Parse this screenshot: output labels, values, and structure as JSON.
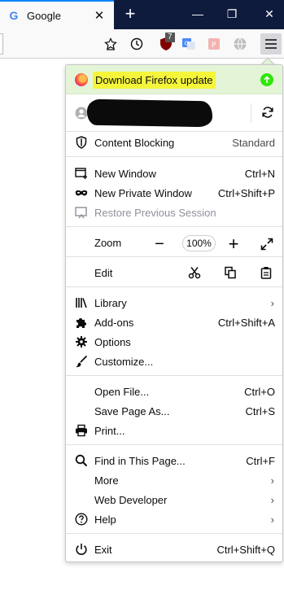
{
  "tab": {
    "favicon": "G",
    "title": "Google",
    "close": "✕"
  },
  "titlebar": {
    "new_tab": "+",
    "minimize": "—",
    "restore": "❐",
    "close": "✕"
  },
  "toolbar": {
    "icons": [
      "bookmark-star-icon",
      "history-clock-icon",
      "ublock-icon",
      "translate-icon",
      "pocket-extension-icon",
      "vpn-globe-icon",
      "hamburger-menu-icon"
    ],
    "ublock_badge": "7"
  },
  "menu": {
    "update_label": "Download Firefox update",
    "content_blocking": {
      "label": "Content Blocking",
      "value": "Standard"
    },
    "new_window": {
      "label": "New Window",
      "shortcut": "Ctrl+N"
    },
    "new_private_window": {
      "label": "New Private Window",
      "shortcut": "Ctrl+Shift+P"
    },
    "restore_session": {
      "label": "Restore Previous Session"
    },
    "zoom": {
      "label": "Zoom",
      "minus": "−",
      "value": "100%",
      "plus": "+"
    },
    "edit": {
      "label": "Edit"
    },
    "library": {
      "label": "Library",
      "chevron": "›"
    },
    "addons": {
      "label": "Add-ons",
      "shortcut": "Ctrl+Shift+A"
    },
    "options": {
      "label": "Options"
    },
    "customize": {
      "label": "Customize..."
    },
    "open_file": {
      "label": "Open File...",
      "shortcut": "Ctrl+O"
    },
    "save_page": {
      "label": "Save Page As...",
      "shortcut": "Ctrl+S"
    },
    "print": {
      "label": "Print..."
    },
    "find": {
      "label": "Find in This Page...",
      "shortcut": "Ctrl+F"
    },
    "more": {
      "label": "More",
      "chevron": "›"
    },
    "web_developer": {
      "label": "Web Developer",
      "chevron": "›"
    },
    "help": {
      "label": "Help",
      "chevron": "›"
    },
    "exit": {
      "label": "Exit",
      "shortcut": "Ctrl+Shift+Q"
    }
  },
  "colors": {
    "titlebar": "#0f1b3d",
    "accent": "#0a84ff",
    "update_bg": "#e4f5d7",
    "highlight": "#f5f53c",
    "update_arrow": "#30e60b"
  }
}
